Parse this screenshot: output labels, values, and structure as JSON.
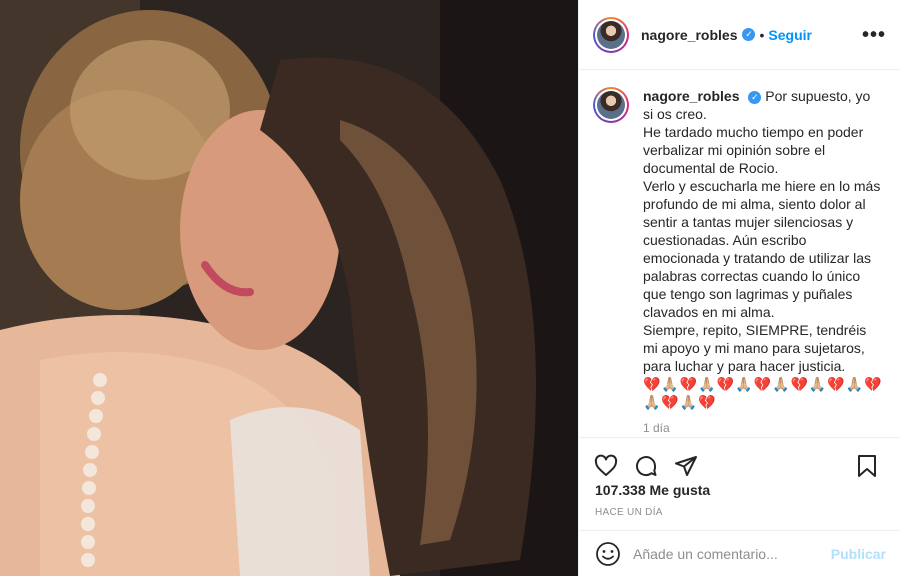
{
  "post": {
    "username": "nagore_robles",
    "verified_mark": "✓",
    "dot": "•",
    "follow_label": "Seguir",
    "more_label": "•••",
    "caption_lead": "Por supuesto, yo si os creo.",
    "caption_body": "He tardado mucho tiempo en poder verbalizar mi opinión sobre el documental de Rocio.\nVerlo y escucharla me hiere en lo más profundo de mi alma, siento dolor al sentir a tantas mujer silenciosas y cuestionadas. Aún escribo emocionada y tratando de utilizar las palabras correctas cuando lo único que tengo son lagrimas y puñales clavados en mi alma.\nSiempre, repito, SIEMPRE, tendréis mi apoyo y mi mano para sujetaros, para luchar y para hacer justicia.",
    "emojis": "💔🙏🏼💔🙏🏼💔🙏🏼💔🙏🏼💔🙏🏼💔🙏🏼💔🙏🏼💔🙏🏼💔",
    "caption_time": "1 día",
    "likes": "107.338 Me gusta",
    "posted_ago": "HACE UN DÍA",
    "comment_placeholder": "Añade un comentario...",
    "publish_label": "Publicar"
  },
  "icons": {
    "like": "heart-icon",
    "comment": "comment-icon",
    "share": "paper-plane-icon",
    "save": "bookmark-icon",
    "emoji": "smiley-icon"
  },
  "colors": {
    "link_blue": "#0095f6",
    "verified_blue": "#3897f0",
    "muted_gray": "#8e8e8e",
    "publish_disabled": "#b2dffc"
  }
}
